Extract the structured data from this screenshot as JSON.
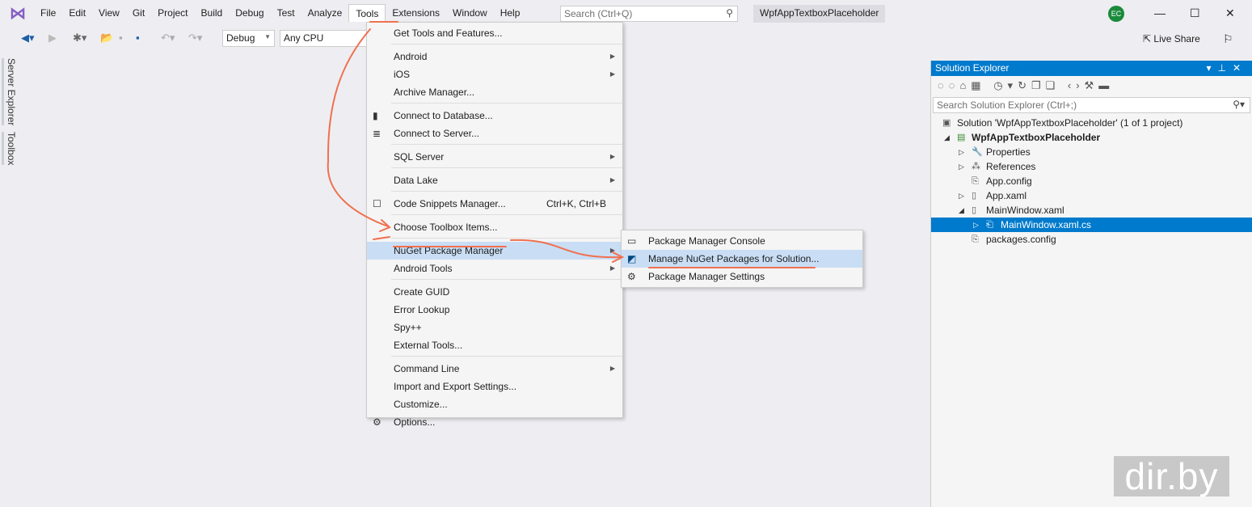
{
  "menubar": {
    "items": [
      "File",
      "Edit",
      "View",
      "Git",
      "Project",
      "Build",
      "Debug",
      "Test",
      "Analyze",
      "Tools",
      "Extensions",
      "Window",
      "Help"
    ],
    "search_placeholder": "Search (Ctrl+Q)",
    "project_name": "WpfAppTextboxPlaceholder",
    "avatar": "EC"
  },
  "toolbar": {
    "config": "Debug",
    "platform": "Any CPU",
    "live_share": "Live Share"
  },
  "side_tabs": [
    "Server Explorer",
    "Toolbox"
  ],
  "tools_menu": [
    {
      "label": "Get Tools and Features..."
    },
    {
      "sep": true
    },
    {
      "label": "Android",
      "sub": true
    },
    {
      "label": "iOS",
      "sub": true
    },
    {
      "label": "Archive Manager..."
    },
    {
      "sep": true
    },
    {
      "label": "Connect to Database...",
      "icon": "database-icon"
    },
    {
      "label": "Connect to Server...",
      "icon": "server-icon"
    },
    {
      "sep": true
    },
    {
      "label": "SQL Server",
      "sub": true
    },
    {
      "sep": true
    },
    {
      "label": "Data Lake",
      "sub": true
    },
    {
      "sep": true
    },
    {
      "label": "Code Snippets Manager...",
      "shortcut": "Ctrl+K, Ctrl+B",
      "icon": "snippet-icon"
    },
    {
      "sep": true
    },
    {
      "label": "Choose Toolbox Items..."
    },
    {
      "sep": true
    },
    {
      "label": "NuGet Package Manager",
      "sub": true,
      "highlight": true
    },
    {
      "label": "Android Tools",
      "sub": true
    },
    {
      "sep": true
    },
    {
      "label": "Create GUID"
    },
    {
      "label": "Error Lookup"
    },
    {
      "label": "Spy++"
    },
    {
      "label": "External Tools..."
    },
    {
      "sep": true
    },
    {
      "label": "Command Line",
      "sub": true
    },
    {
      "label": "Import and Export Settings..."
    },
    {
      "label": "Customize..."
    },
    {
      "label": "Options...",
      "icon": "gear-icon"
    }
  ],
  "nuget_menu": [
    {
      "label": "Package Manager Console",
      "icon": "console-icon"
    },
    {
      "label": "Manage NuGet Packages for Solution...",
      "icon": "nuget-icon",
      "highlight": true
    },
    {
      "label": "Package Manager Settings",
      "icon": "gear-icon"
    }
  ],
  "solution_explorer": {
    "title": "Solution Explorer",
    "search_placeholder": "Search Solution Explorer (Ctrl+;)",
    "tree": [
      {
        "label": "Solution 'WpfAppTextboxPlaceholder' (1 of 1 project)",
        "level": 0,
        "icon": "solution-icon"
      },
      {
        "label": "WpfAppTextboxPlaceholder",
        "level": 1,
        "expand": "open",
        "icon": "csharp-project-icon",
        "bold": true
      },
      {
        "label": "Properties",
        "level": 2,
        "expand": "closed",
        "icon": "wrench-icon"
      },
      {
        "label": "References",
        "level": 2,
        "expand": "closed",
        "icon": "references-icon"
      },
      {
        "label": "App.config",
        "level": 2,
        "icon": "config-icon"
      },
      {
        "label": "App.xaml",
        "level": 2,
        "expand": "closed",
        "icon": "xaml-icon"
      },
      {
        "label": "MainWindow.xaml",
        "level": 2,
        "expand": "open",
        "icon": "xaml-icon"
      },
      {
        "label": "MainWindow.xaml.cs",
        "level": 3,
        "expand": "closed",
        "icon": "cs-file-icon",
        "selected": true
      },
      {
        "label": "packages.config",
        "level": 2,
        "icon": "config-icon"
      }
    ]
  },
  "watermark": "dir.by",
  "colors": {
    "accent": "#007acc",
    "annotation": "#f07050",
    "highlight": "#c9def5"
  }
}
